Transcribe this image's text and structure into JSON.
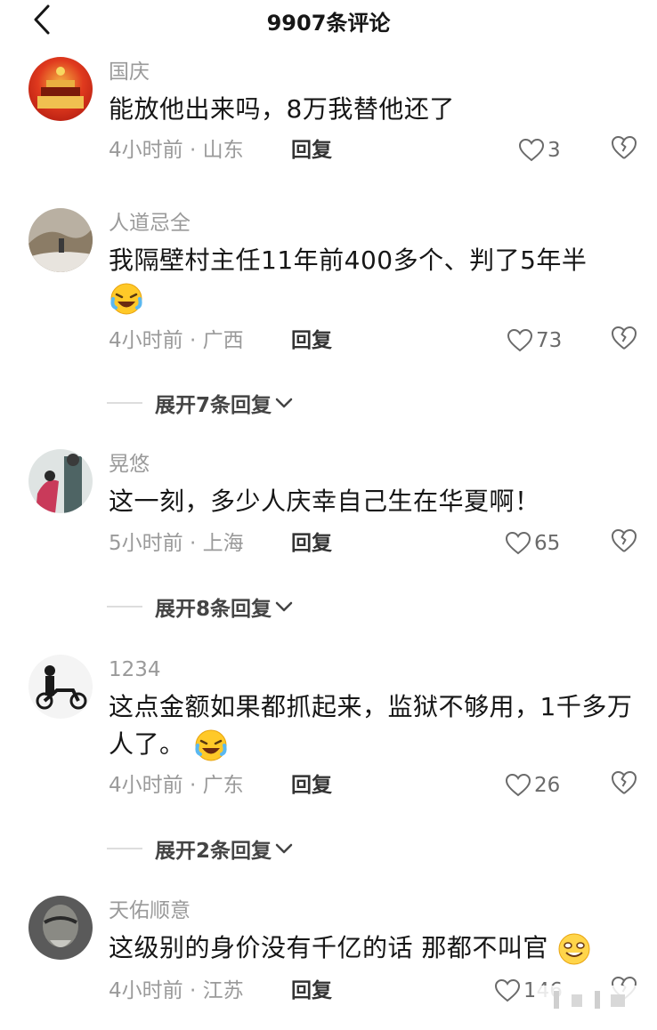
{
  "header": {
    "title": "9907条评论",
    "back_icon": "chevron-left-icon"
  },
  "comments": [
    {
      "name": "国庆",
      "text": "能放他出来吗，8万我替他还了",
      "meta": "4小时前 · 山东",
      "reply": "回复",
      "likes": "3"
    },
    {
      "name": "人道忌全",
      "text": "我隔壁村主任11年前400多个、判了5年半",
      "emoji": "laughing-crying-emoji",
      "meta": "4小时前 · 广西",
      "reply": "回复",
      "likes": "73",
      "expand": "展开7条回复"
    },
    {
      "name": "晃悠",
      "text": "这一刻，多少人庆幸自己生在华夏啊！",
      "meta": "5小时前 · 上海",
      "reply": "回复",
      "likes": "65",
      "expand": "展开8条回复"
    },
    {
      "name": "1234",
      "text": "这点金额如果都抓起来，监狱不够用，1千多万人了。",
      "emoji": "laughing-crying-emoji",
      "meta": "4小时前 · 广东",
      "reply": "回复",
      "likes": "26",
      "expand": "展开2条回复"
    },
    {
      "name": "天佑顺意",
      "text": "这级别的身价没有千亿的话 那都不叫官",
      "emoji": "grinning-emoji",
      "meta": "4小时前 · 江苏",
      "reply": "回复",
      "likes": "146"
    }
  ],
  "colors": {
    "secondary_text": "#9a9a9a",
    "primary_text": "#161616",
    "divider": "#dddddd"
  }
}
